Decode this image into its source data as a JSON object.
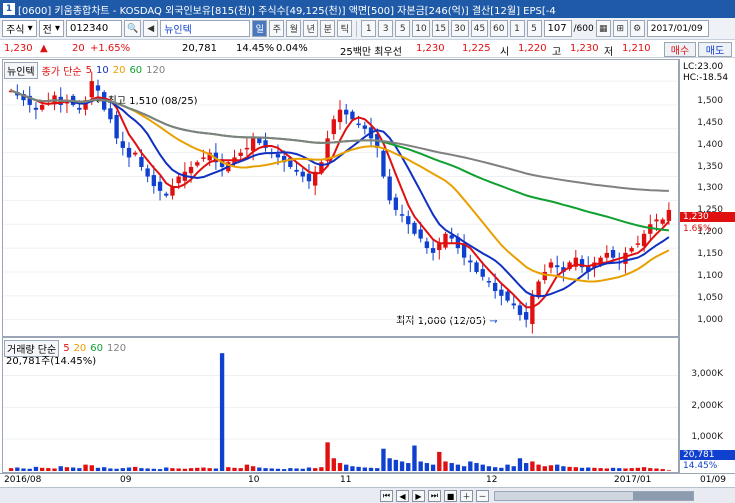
{
  "window": {
    "number": "1",
    "title": "[0600] 키움종합차트 - KOSDAQ 외국인보유[815(천)] 주식수[49,125(천)] 액면[500] 자본금[246(억)] 결산[12월] EPS[-4"
  },
  "toolbar": {
    "market": "주식",
    "market_option": "전",
    "code": "012340",
    "stock_name": "뉴인텍",
    "periods": [
      "일",
      "주",
      "월",
      "년",
      "분",
      "틱"
    ],
    "active_period": "일",
    "intervals": [
      "1",
      "3",
      "5",
      "10",
      "15",
      "30",
      "45",
      "60",
      "1",
      "5"
    ],
    "count": "107",
    "count_total": "/600",
    "date": "2017/01/09"
  },
  "quote": {
    "price": "1,230",
    "change_sign": "▲",
    "change": "20",
    "change_pct": "+1.65%",
    "volume": "20,781",
    "volume_ratio": "14.45%",
    "turnover": "0.04%",
    "best_label": "25백만 최우선",
    "ask": "1,230",
    "bid": "1,225",
    "open_label": "시",
    "open": "1,220",
    "high_label": "고",
    "high": "1,230",
    "low_label": "저",
    "low": "1,210",
    "buy_button": "매수",
    "sell_button": "매도"
  },
  "price_panel": {
    "stock_tag": "뉴인텍",
    "ma_label": "종가 단순",
    "ma_periods": [
      "5",
      "10",
      "20",
      "60",
      "120"
    ],
    "ma_colors": [
      "#e01010",
      "#1030c0",
      "#e8a000",
      "#10a030",
      "#808080"
    ],
    "high_annotation": "최고 1,510 (08/25)",
    "low_annotation": "최저 1,000 (12/05)",
    "price_axis_labels": [
      "1,500",
      "1,450",
      "1,400",
      "1,350",
      "1,300",
      "1,250",
      "1,200",
      "1,150",
      "1,100",
      "1,050",
      "1,000"
    ],
    "lc_label": "LC:23.00",
    "hc_label": "HC:-18.54",
    "current_price_tag": "1,230",
    "current_pct_tag": "1.65%"
  },
  "volume_panel": {
    "label": "거래량 단순",
    "ma_periods": [
      "5",
      "20",
      "60",
      "120"
    ],
    "current_volume": "20,781주(14.45%)",
    "axis_labels": [
      "3,000K",
      "2,000K",
      "1,000K"
    ],
    "current_volume_tag": "20,781",
    "current_pct_tag": "14.45%"
  },
  "date_axis": [
    "2016/08",
    "09",
    "10",
    "11",
    "12",
    "2017/01",
    "01/09"
  ],
  "colors": {
    "up": "#e01010",
    "down": "#1040d0",
    "title_bar": "#1f5aa8"
  },
  "chart_data": [
    {
      "type": "candlestick",
      "title": "뉴인텍",
      "ylim": [
        970,
        1540
      ],
      "close_series": [
        1480,
        1470,
        1460,
        1450,
        1440,
        1450,
        1460,
        1470,
        1450,
        1460,
        1450,
        1440,
        1460,
        1500,
        1480,
        1440,
        1420,
        1380,
        1360,
        1340,
        1350,
        1320,
        1300,
        1280,
        1270,
        1260,
        1280,
        1300,
        1310,
        1320,
        1330,
        1340,
        1350,
        1330,
        1320,
        1330,
        1340,
        1350,
        1360,
        1380,
        1370,
        1360,
        1350,
        1340,
        1330,
        1320,
        1310,
        1300,
        1290,
        1310,
        1330,
        1380,
        1420,
        1440,
        1430,
        1420,
        1410,
        1400,
        1380,
        1360,
        1300,
        1250,
        1230,
        1220,
        1200,
        1180,
        1170,
        1150,
        1140,
        1160,
        1180,
        1170,
        1150,
        1130,
        1120,
        1100,
        1090,
        1080,
        1060,
        1050,
        1040,
        1030,
        1010,
        1000,
        1050,
        1080,
        1100,
        1120,
        1110,
        1100,
        1120,
        1130,
        1110,
        1100,
        1120,
        1130,
        1140,
        1130,
        1120,
        1140,
        1150,
        1160,
        1180,
        1200,
        1210,
        1210,
        1230
      ],
      "high": 1510,
      "low": 1000
    },
    {
      "type": "bar",
      "title": "거래량",
      "ylim": [
        0,
        3800
      ],
      "unit": "K",
      "values": [
        90,
        110,
        80,
        70,
        130,
        100,
        90,
        80,
        150,
        120,
        110,
        90,
        200,
        180,
        100,
        120,
        80,
        70,
        90,
        110,
        130,
        90,
        80,
        70,
        60,
        110,
        90,
        80,
        70,
        90,
        100,
        110,
        90,
        80,
        3700,
        120,
        100,
        90,
        200,
        150,
        110,
        90,
        80,
        70,
        60,
        90,
        80,
        70,
        110,
        90,
        120,
        900,
        400,
        250,
        200,
        150,
        130,
        110,
        100,
        90,
        700,
        400,
        350,
        300,
        250,
        800,
        300,
        250,
        200,
        600,
        300,
        250,
        200,
        150,
        300,
        250,
        200,
        150,
        120,
        100,
        200,
        150,
        400,
        250,
        300,
        200,
        150,
        180,
        200,
        150,
        130,
        120,
        100,
        110,
        100,
        90,
        80,
        100,
        90,
        80,
        90,
        100,
        120,
        90,
        80,
        60,
        20
      ]
    }
  ]
}
